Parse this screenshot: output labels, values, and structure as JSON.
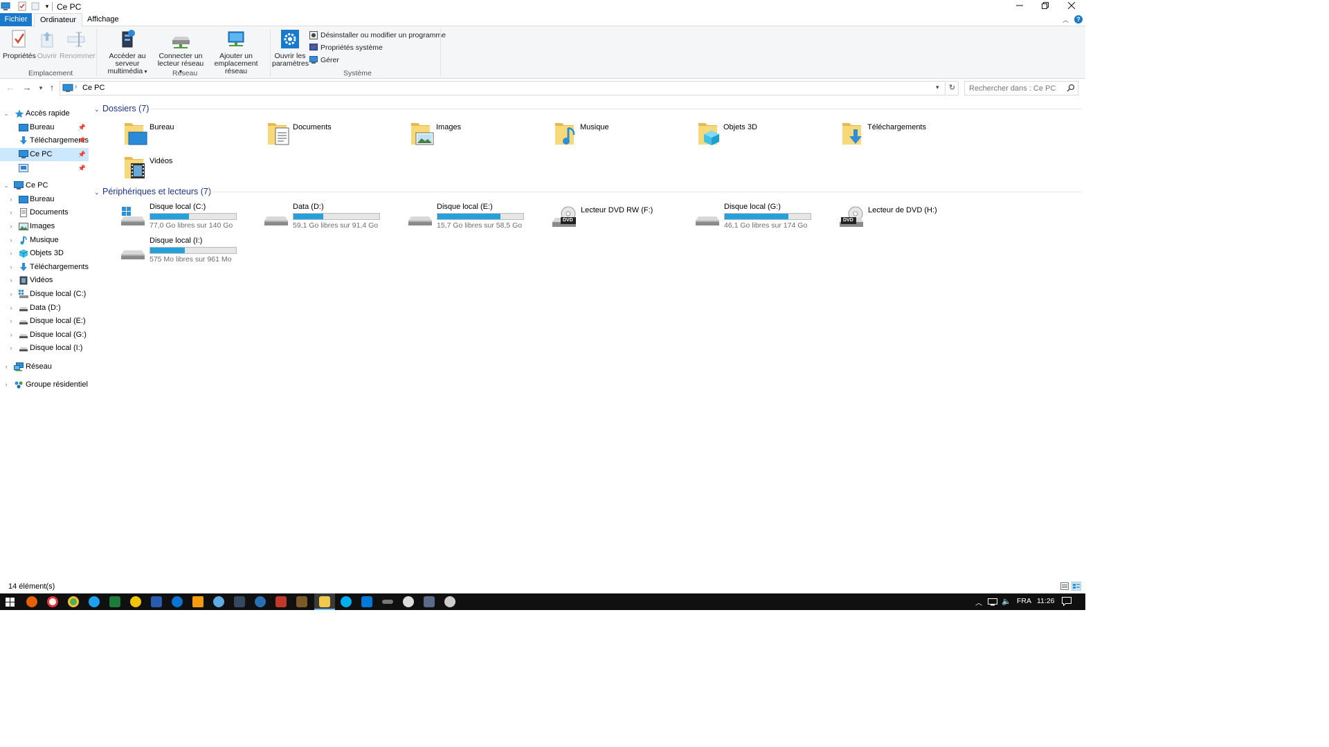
{
  "window": {
    "title": "Ce PC"
  },
  "ribbon_tabs": {
    "file": "Fichier",
    "computer": "Ordinateur",
    "view": "Affichage"
  },
  "ribbon": {
    "location": {
      "group_label": "Emplacement",
      "properties": "Propriétés",
      "open": "Ouvrir",
      "rename": "Renommer"
    },
    "network": {
      "group_label": "Réseau",
      "media_server_l1": "Accéder au serveur",
      "media_server_l2": "multimédia",
      "map_drive_l1": "Connecter un",
      "map_drive_l2": "lecteur réseau",
      "add_location_l1": "Ajouter un",
      "add_location_l2": "emplacement réseau"
    },
    "system": {
      "group_label": "Système",
      "settings_l1": "Ouvrir les",
      "settings_l2": "paramètres",
      "uninstall": "Désinstaller ou modifier un programme",
      "sys_props": "Propriétés système",
      "manage": "Gérer"
    }
  },
  "address": {
    "path": "Ce PC",
    "search_placeholder": "Rechercher dans : Ce PC"
  },
  "nav": {
    "quick_access": "Accès rapide",
    "qa_items": [
      "Bureau",
      "Téléchargements",
      "Ce PC"
    ],
    "this_pc": "Ce PC",
    "pc_items": [
      "Bureau",
      "Documents",
      "Images",
      "Musique",
      "Objets 3D",
      "Téléchargements",
      "Vidéos",
      "Disque local (C:)",
      "Data (D:)",
      "Disque local (E:)",
      "Disque local (G:)",
      "Disque local (I:)"
    ],
    "network": "Réseau",
    "homegroup": "Groupe résidentiel"
  },
  "content": {
    "folders_header": "Dossiers (7)",
    "folders": [
      "Bureau",
      "Documents",
      "Images",
      "Musique",
      "Objets 3D",
      "Téléchargements",
      "Vidéos"
    ],
    "drives_header": "Périphériques et lecteurs (7)",
    "drives": [
      {
        "name": "Disque local (C:)",
        "free": "77,0 Go libres sur 140 Go",
        "used_fraction": 0.45
      },
      {
        "name": "Data (D:)",
        "free": "59,1 Go libres sur 91,4 Go",
        "used_fraction": 0.35
      },
      {
        "name": "Disque local (E:)",
        "free": "15,7 Go libres sur 58,5 Go",
        "used_fraction": 0.73
      },
      {
        "name": "Lecteur DVD RW (F:)",
        "free": "",
        "used_fraction": null
      },
      {
        "name": "Disque local (G:)",
        "free": "46,1 Go libres sur 174 Go",
        "used_fraction": 0.74
      },
      {
        "name": "Lecteur de DVD (H:)",
        "free": "",
        "used_fraction": null
      },
      {
        "name": "Disque local (I:)",
        "free": "575 Mo libres sur 961 Mo",
        "used_fraction": 0.4
      }
    ],
    "dvd_badge": "DVD"
  },
  "status": {
    "count": "14 élément(s)"
  },
  "taskbar": {
    "lang": "FRA",
    "time": "11:26"
  },
  "colors": {
    "accent": "#1979ca",
    "bar_fill": "#26a0da",
    "selection": "#cce8ff",
    "header_text": "#1e3287"
  }
}
